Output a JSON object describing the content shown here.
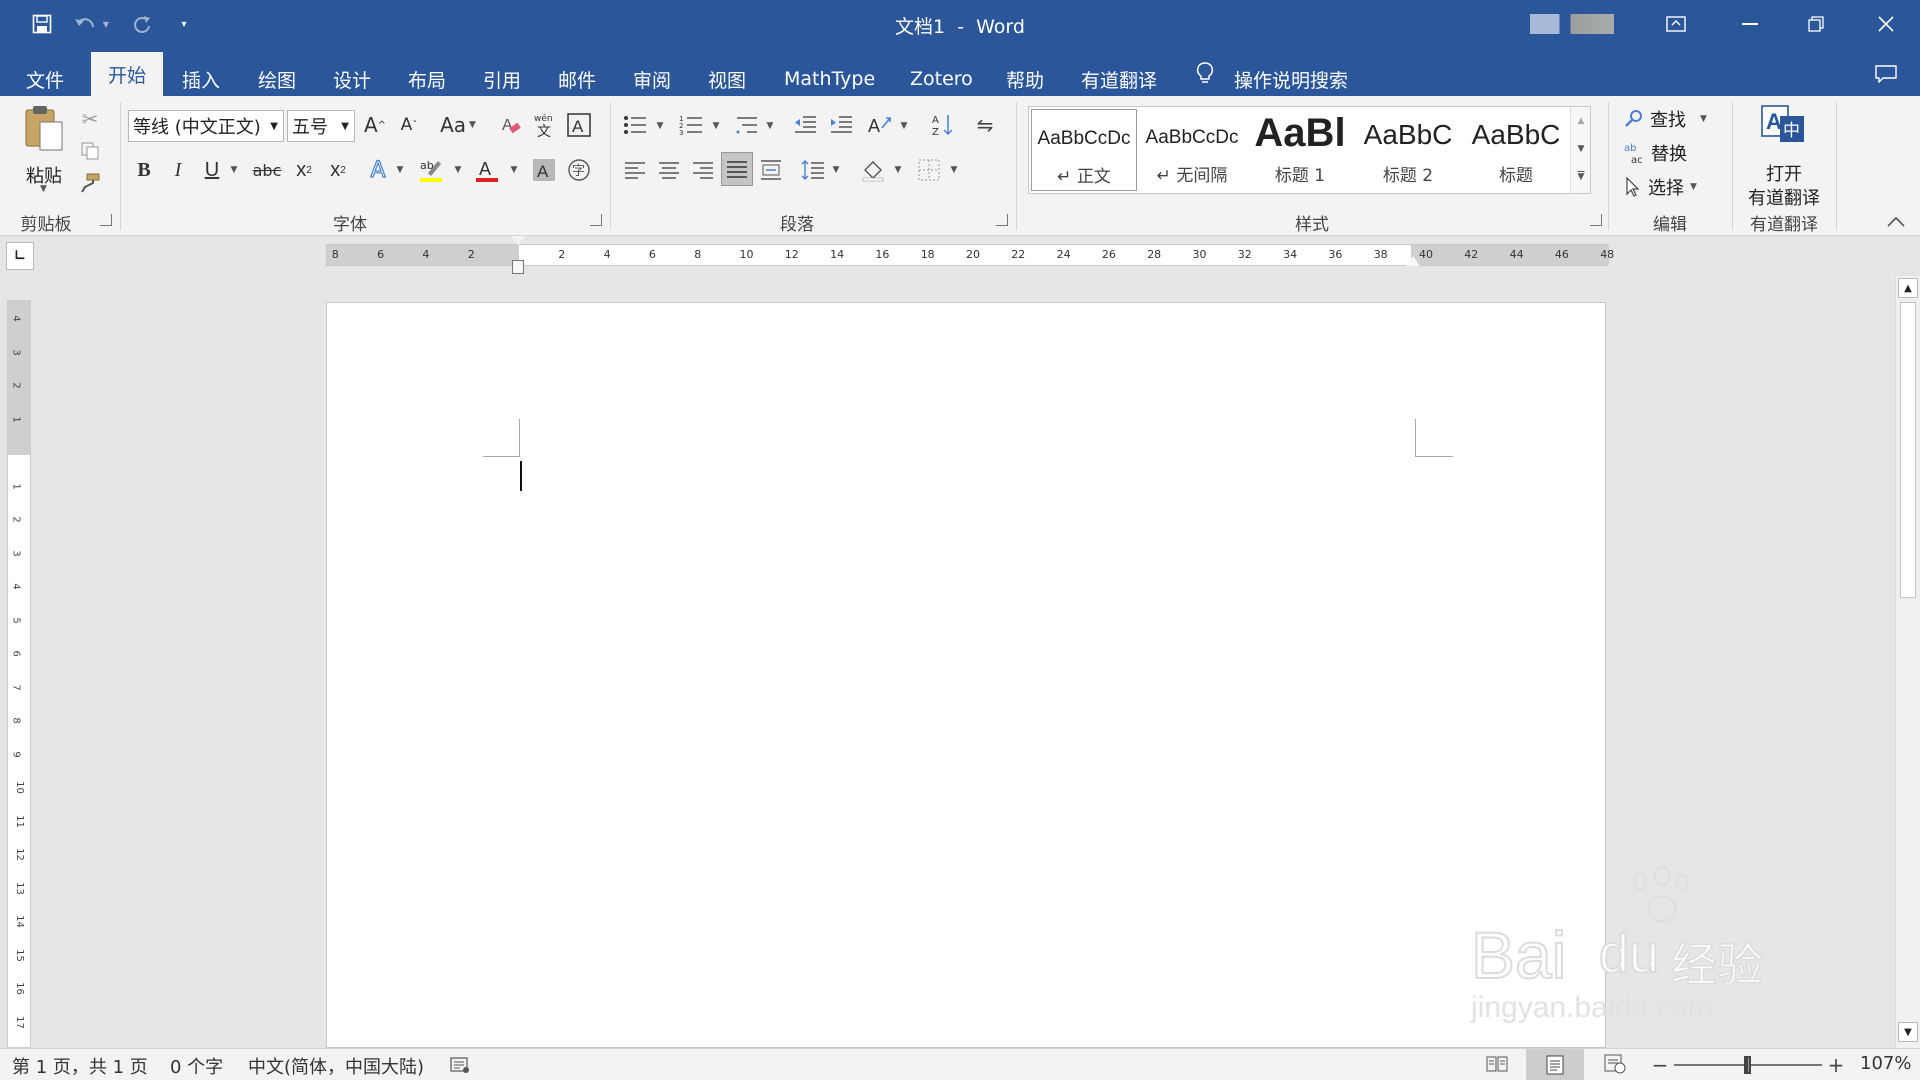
{
  "window": {
    "title": "文档1  -  Word"
  },
  "tabs": [
    {
      "label": "文件"
    },
    {
      "label": "开始"
    },
    {
      "label": "插入"
    },
    {
      "label": "绘图"
    },
    {
      "label": "设计"
    },
    {
      "label": "布局"
    },
    {
      "label": "引用"
    },
    {
      "label": "邮件"
    },
    {
      "label": "审阅"
    },
    {
      "label": "视图"
    },
    {
      "label": "MathType"
    },
    {
      "label": "Zotero"
    },
    {
      "label": "帮助"
    },
    {
      "label": "有道翻译"
    }
  ],
  "tell_me": {
    "label": "操作说明搜索"
  },
  "ribbon": {
    "clipboard": {
      "paste_label": "粘贴",
      "group_label": "剪贴板"
    },
    "font": {
      "font_name": "等线 (中文正文)",
      "font_size": "五号",
      "change_case": "Aa",
      "group_label": "字体",
      "font_color": "#e02020",
      "highlight_color": "#ffff00"
    },
    "paragraph": {
      "group_label": "段落"
    },
    "styles": {
      "group_label": "样式",
      "items": [
        {
          "preview": "AaBbCcDc",
          "name": "↵ 正文"
        },
        {
          "preview": "AaBbCcDc",
          "name": "↵ 无间隔"
        },
        {
          "preview": "AaBl",
          "name": "标题 1"
        },
        {
          "preview": "AaBbC",
          "name": "标题 2"
        },
        {
          "preview": "AaBbC",
          "name": "标题"
        }
      ]
    },
    "editing": {
      "find": "查找",
      "replace": "替换",
      "select": "选择",
      "group_label": "编辑"
    },
    "youdao": {
      "button_label_1": "打开",
      "button_label_2": "有道翻译",
      "group_label": "有道翻译"
    }
  },
  "ruler": {
    "horizontal_ticks": [
      "8",
      "6",
      "4",
      "2",
      "2",
      "4",
      "6",
      "8",
      "10",
      "12",
      "14",
      "16",
      "18",
      "20",
      "22",
      "24",
      "26",
      "28",
      "30",
      "32",
      "34",
      "36",
      "38",
      "40",
      "42",
      "44",
      "46",
      "48"
    ],
    "vertical_ticks": [
      "4",
      "3",
      "2",
      "1",
      "1",
      "2",
      "3",
      "4",
      "5",
      "6",
      "7",
      "8",
      "9",
      "10",
      "11",
      "12",
      "13",
      "14",
      "15",
      "16",
      "17"
    ]
  },
  "statusbar": {
    "page": "第 1 页，共 1 页",
    "words": "0 个字",
    "language": "中文(简体，中国大陆)",
    "zoom": "107%"
  },
  "colors": {
    "brand": "#2b579a",
    "ribbon_bg": "#f3f3f3"
  },
  "watermark": {
    "text1": "Bai",
    "text2": "du",
    "text3": "经验",
    "url": "jingyan.baidu.com"
  }
}
